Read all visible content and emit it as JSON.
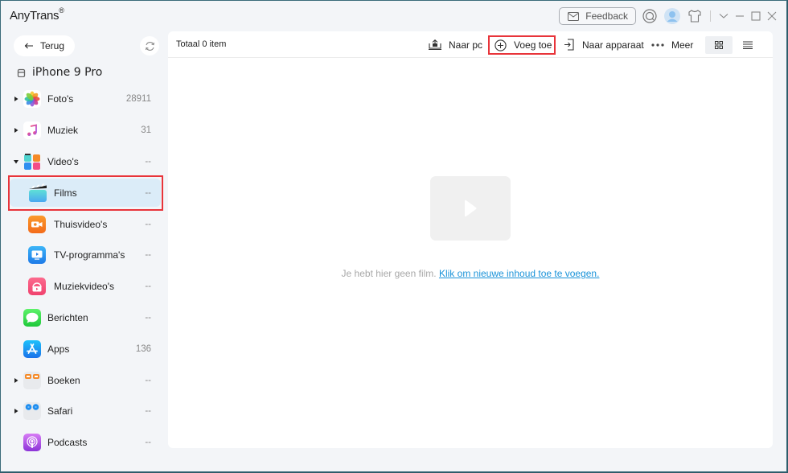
{
  "app": {
    "title": "AnyTrans",
    "registered_mark": "®"
  },
  "titlebar": {
    "feedback_label": "Feedback",
    "icons": [
      "mail-icon",
      "support-icon",
      "avatar-icon",
      "shirt-icon",
      "chevron-down-icon",
      "minimize-icon",
      "maximize-icon",
      "close-icon"
    ]
  },
  "sidebar": {
    "back_label": "Terug",
    "device_name": "iPhone 9 Pro",
    "items": [
      {
        "label": "Foto's",
        "count": "28911",
        "expandable": true,
        "expanded": false,
        "icon": "photos-icon"
      },
      {
        "label": "Muziek",
        "count": "31",
        "expandable": true,
        "expanded": false,
        "icon": "music-icon"
      },
      {
        "label": "Video's",
        "count": "--",
        "expandable": true,
        "expanded": true,
        "icon": "videos-icon"
      },
      {
        "label": "Films",
        "count": "--",
        "sub": true,
        "selected": true,
        "icon": "films-icon"
      },
      {
        "label": "Thuisvideo's",
        "count": "--",
        "sub": true,
        "icon": "home-video-icon"
      },
      {
        "label": "TV-programma's",
        "count": "--",
        "sub": true,
        "icon": "tv-icon"
      },
      {
        "label": "Muziekvideo's",
        "count": "--",
        "sub": true,
        "icon": "music-video-icon"
      },
      {
        "label": "Berichten",
        "count": "--",
        "icon": "messages-icon"
      },
      {
        "label": "Apps",
        "count": "136",
        "icon": "appstore-icon"
      },
      {
        "label": "Boeken",
        "count": "--",
        "expandable": true,
        "expanded": false,
        "icon": "books-icon"
      },
      {
        "label": "Safari",
        "count": "--",
        "expandable": true,
        "expanded": false,
        "icon": "safari-icon"
      },
      {
        "label": "Podcasts",
        "count": "--",
        "icon": "podcasts-icon"
      }
    ]
  },
  "toolbar": {
    "total_label": "Totaal 0 item",
    "to_pc_label": "Naar pc",
    "add_label": "Voeg toe",
    "to_device_label": "Naar apparaat",
    "more_label": "Meer",
    "view_mode": "grid"
  },
  "content": {
    "empty_text": "Je hebt hier geen film.",
    "empty_link": "Klik om nieuwe inhoud toe te voegen."
  },
  "colors": {
    "accent_link": "#1a93d9",
    "highlight_red": "#e8343a",
    "selected_bg": "#dbecf8"
  }
}
